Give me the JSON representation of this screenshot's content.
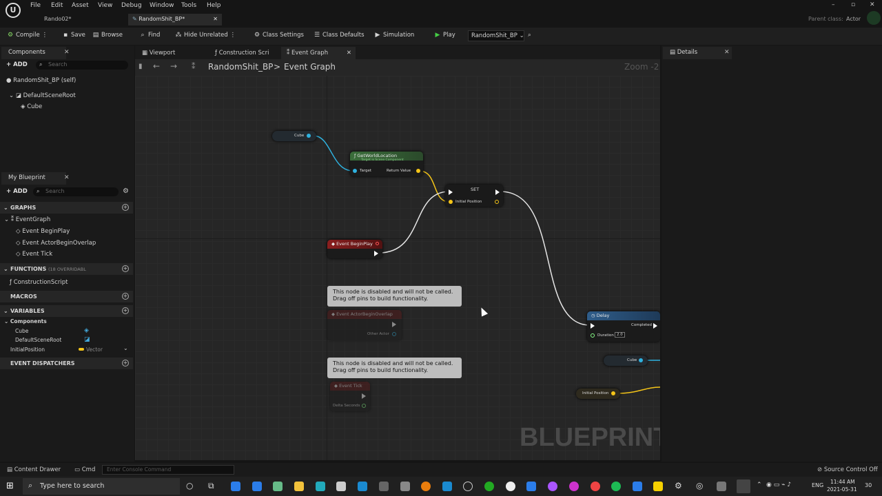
{
  "menu": [
    "File",
    "Edit",
    "Asset",
    "View",
    "Debug",
    "Window",
    "Tools",
    "Help"
  ],
  "doc_tabs": [
    {
      "label": "Rando02*"
    },
    {
      "label": "RandomShit_BP*"
    }
  ],
  "parent_class_label": "Parent class:",
  "parent_class_value": "Actor",
  "toolbar": {
    "compile": "Compile",
    "save": "Save",
    "browse": "Browse",
    "find": "Find",
    "hide_unrelated": "Hide Unrelated",
    "class_settings": "Class Settings",
    "class_defaults": "Class Defaults",
    "simulation": "Simulation",
    "play": "Play",
    "debug_object": "RandomShit_BP"
  },
  "components": {
    "tab": "Components",
    "add": "ADD",
    "search_placeholder": "Search",
    "self": "RandomShit_BP (self)",
    "root": "DefaultSceneRoot",
    "child": "Cube"
  },
  "my_blueprint": {
    "tab": "My Blueprint",
    "add": "ADD",
    "search_placeholder": "Search",
    "graphs": "GRAPHS",
    "event_graph": "EventGraph",
    "events": [
      "Event BeginPlay",
      "Event ActorBeginOverlap",
      "Event Tick"
    ],
    "functions": "FUNCTIONS",
    "functions_note": "(18 OVERRIDABL",
    "construction": "ConstructionScript",
    "macros": "MACROS",
    "variables": "VARIABLES",
    "var_components": "Components",
    "comp_vars": [
      "Cube",
      "DefaultSceneRoot"
    ],
    "initial_position": "InitialPosition",
    "vector_type": "Vector",
    "dispatchers": "EVENT DISPATCHERS"
  },
  "graph_tabs": [
    "Viewport",
    "Construction Scri",
    "Event Graph"
  ],
  "breadcrumb": {
    "bp": "RandomShit_BP",
    "sep": ">",
    "graph": "Event Graph"
  },
  "zoom": "Zoom -2",
  "details_tab": "Details",
  "nodes": {
    "cube_ref": "Cube",
    "getloc_title": "GetWorldLocation",
    "getloc_sub": "Target is Scene Component",
    "target": "Target",
    "return_value": "Return Value",
    "set_title": "SET",
    "initial_position": "Initial Position",
    "begin_play": "Event BeginPlay",
    "disabled_msg1": "This node is disabled and will not be called.",
    "disabled_msg2": "Drag off pins to build functionality.",
    "overlap": "Event ActorBeginOverlap",
    "other_actor": "Other Actor",
    "tick": "Event Tick",
    "delta": "Delta Seconds",
    "delay": "Delay",
    "completed": "Completed",
    "duration": "Duration",
    "duration_val": "2.0",
    "cube_ref2": "Cube",
    "initpos_ref": "Initial Position"
  },
  "watermark": "BLUEPRINT",
  "status": {
    "content_drawer": "Content Drawer",
    "cmd": "Cmd",
    "console_placeholder": "Enter Console Command",
    "source_control": "Source Control Off"
  },
  "taskbar": {
    "search": "Type here to search",
    "lang": "ENG",
    "time": "11:44 AM",
    "date": "2021-05-31",
    "notif": "30"
  }
}
